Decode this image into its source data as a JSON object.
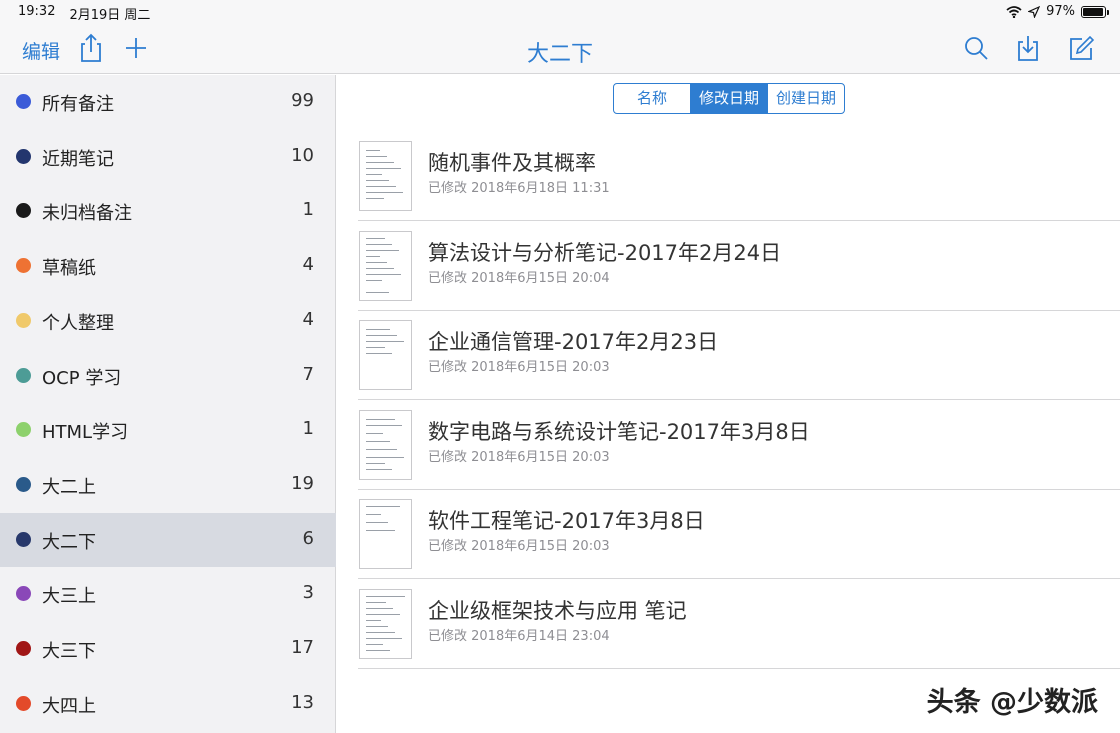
{
  "status": {
    "time": "19:32",
    "date": "2月19日 周二",
    "battery_text": "97%",
    "battery_level": 0.97
  },
  "nav": {
    "edit": "编辑",
    "title": "大二下",
    "accent": "#2e7dd1"
  },
  "sidebar": {
    "items": [
      {
        "label": "所有备注",
        "count": "99",
        "color": "#3b5bd8",
        "selected": false
      },
      {
        "label": "近期笔记",
        "count": "10",
        "color": "#23366e",
        "selected": false
      },
      {
        "label": "未归档备注",
        "count": "1",
        "color": "#1a1a1a",
        "selected": false
      },
      {
        "label": "草稿纸",
        "count": "4",
        "color": "#ee7233",
        "selected": false
      },
      {
        "label": "个人整理",
        "count": "4",
        "color": "#f0c96a",
        "selected": false
      },
      {
        "label": "OCP 学习",
        "count": "7",
        "color": "#4d9c96",
        "selected": false
      },
      {
        "label": "HTML学习",
        "count": "1",
        "color": "#8dd16c",
        "selected": false
      },
      {
        "label": "大二上",
        "count": "19",
        "color": "#2a5a8a",
        "selected": false
      },
      {
        "label": "大二下",
        "count": "6",
        "color": "#27386b",
        "selected": true
      },
      {
        "label": "大三上",
        "count": "3",
        "color": "#8a48b8",
        "selected": false
      },
      {
        "label": "大三下",
        "count": "17",
        "color": "#a11616",
        "selected": false
      },
      {
        "label": "大四上",
        "count": "13",
        "color": "#e34a2a",
        "selected": false
      }
    ]
  },
  "sort": {
    "options": [
      {
        "label": "名称",
        "active": false
      },
      {
        "label": "修改日期",
        "active": true
      },
      {
        "label": "创建日期",
        "active": false
      }
    ]
  },
  "notes": [
    {
      "title": "随机事件及其概率",
      "date": "已修改 2018年6月18日 11:31"
    },
    {
      "title": "算法设计与分析笔记-2017年2月24日",
      "date": "已修改 2018年6月15日 20:04"
    },
    {
      "title": "企业通信管理-2017年2月23日",
      "date": "已修改 2018年6月15日 20:03"
    },
    {
      "title": "数字电路与系统设计笔记-2017年3月8日",
      "date": "已修改 2018年6月15日 20:03"
    },
    {
      "title": "软件工程笔记-2017年3月8日",
      "date": "已修改 2018年6月15日 20:03"
    },
    {
      "title": "企业级框架技术与应用 笔记",
      "date": "已修改 2018年6月14日 23:04"
    }
  ],
  "watermark": "头条 @少数派"
}
